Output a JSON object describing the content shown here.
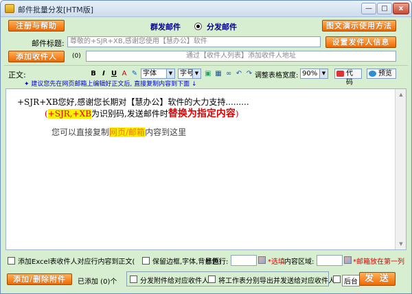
{
  "window": {
    "title": "邮件批量分发[HTM版]",
    "min_label": "—",
    "max_label": "□",
    "close_label": "x"
  },
  "top": {
    "register_help_label": "注册与帮助",
    "mode_group": "群发邮件",
    "mode_distribute": "分发邮件",
    "mode_selected": "分发邮件",
    "demo_button_label": "图文演示使用方法"
  },
  "subject": {
    "label": "邮件标题:",
    "value": "尊敬的+SJR+XB,感谢您使用【慧办公】软件",
    "sender_button_label": "设置发件人信息"
  },
  "recipients": {
    "add_button_label": "添加收件人",
    "count": "(0)",
    "hint": "通过【收件人列表】添加收件人地址"
  },
  "toolbar": {
    "body_label": "正文:",
    "bold": "B",
    "italic": "I",
    "underline": "U",
    "font_placeholder": "字体",
    "size_placeholder": "字号",
    "table_width_label": "调整表格宽度:",
    "table_width_value": "90%",
    "code_button": "代码",
    "preview_button": "预览",
    "tip": "建议您先在网页邮箱上编辑好正文后, 直接复制内容到下面"
  },
  "editor": {
    "line1_prefix": "+SJR+XB您好,感谢您长期对【慧办公】软件的大力支持.........",
    "line2_paren_open": "(",
    "line2_highlight": "+SJR,+XB",
    "line2_middle": "为识别码,发送邮件时",
    "line2_emphasis": "替换为指定内容",
    "line2_paren_close": ")",
    "line3_prefix": "您可以直接复制",
    "line3_highlight": "网页/邮箱",
    "line3_suffix": "内容到这里"
  },
  "bottom_row1": {
    "excel_checkbox_label": "添加Excel表收件人对应行内容到正文(",
    "keep_style_label": "保留边框,字体,背景色)",
    "title_row_label": "标题行:",
    "title_row_note": "*选填",
    "content_area_label": "内容区域:",
    "content_area_note": "*邮箱放在第一列"
  },
  "bottom_row2": {
    "attachment_button_label": "添加/删除附件",
    "attachment_count": "已添加 (0)个",
    "distribute_attach_label": "分发附件给对应收件人",
    "export_sheet_label": "将工作表分别导出并发送给对应收件人",
    "background_label": "后台",
    "send_button_label": "发 送"
  },
  "colors": {
    "window_bg": "#d7eed0",
    "orange_button": "#f06a00",
    "emphasis_red": "#e00000",
    "highlight_yellow": "#ffee00",
    "tip_blue": "#0000cc"
  }
}
